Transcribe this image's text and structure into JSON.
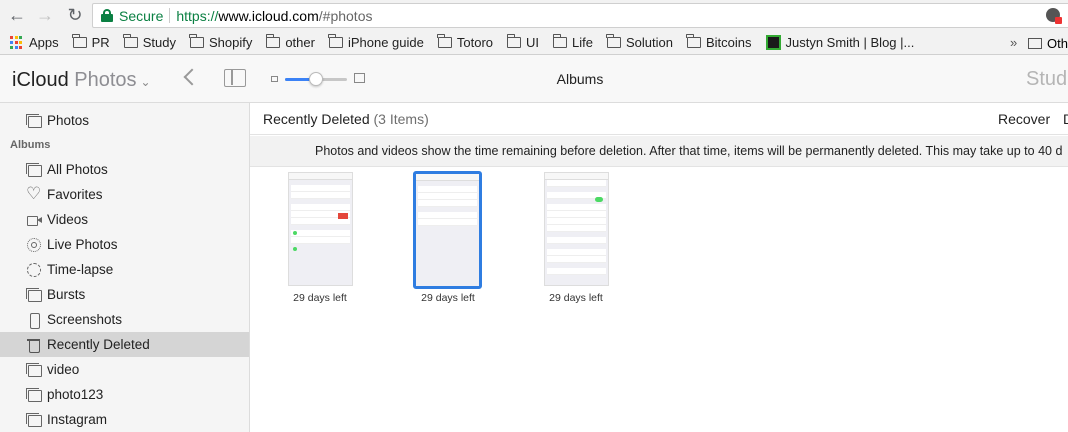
{
  "browser": {
    "secure_label": "Secure",
    "url_scheme": "https://",
    "url_host": "www.icloud.com",
    "url_path": "/#photos",
    "bookmarks": [
      {
        "label": "Apps",
        "icon": "apps-grid-icon"
      },
      {
        "label": "PR",
        "icon": "folder-icon"
      },
      {
        "label": "Study",
        "icon": "folder-icon"
      },
      {
        "label": "Shopify",
        "icon": "folder-icon"
      },
      {
        "label": "other",
        "icon": "folder-icon"
      },
      {
        "label": "iPhone guide",
        "icon": "folder-icon"
      },
      {
        "label": "Totoro",
        "icon": "folder-icon"
      },
      {
        "label": "UI",
        "icon": "folder-icon"
      },
      {
        "label": "Life",
        "icon": "folder-icon"
      },
      {
        "label": "Solution",
        "icon": "folder-icon"
      },
      {
        "label": "Bitcoins",
        "icon": "folder-icon"
      },
      {
        "label": "Justyn Smith | Blog |...",
        "icon": "site-favicon"
      }
    ],
    "bookmarks_more": "»",
    "bookmarks_last": "Oth"
  },
  "app": {
    "brand": "iCloud",
    "section": "Photos",
    "title": "Albums",
    "user": "Stud",
    "zoom_fraction": 0.5,
    "accent_color": "#3b82f6"
  },
  "sidebar": {
    "top_item": "Photos",
    "albums_heading": "Albums",
    "items": [
      {
        "label": "All Photos",
        "icon": "photos-stack-icon"
      },
      {
        "label": "Favorites",
        "icon": "heart-icon"
      },
      {
        "label": "Videos",
        "icon": "video-camera-icon"
      },
      {
        "label": "Live Photos",
        "icon": "live-photo-icon"
      },
      {
        "label": "Time-lapse",
        "icon": "timelapse-icon"
      },
      {
        "label": "Bursts",
        "icon": "bursts-stack-icon"
      },
      {
        "label": "Screenshots",
        "icon": "phone-screenshot-icon"
      },
      {
        "label": "Recently Deleted",
        "icon": "trash-icon",
        "selected": true
      },
      {
        "label": "video",
        "icon": "album-stack-icon"
      },
      {
        "label": "photo123",
        "icon": "album-stack-icon"
      },
      {
        "label": "Instagram",
        "icon": "album-stack-icon"
      }
    ]
  },
  "main": {
    "title": "Recently Deleted",
    "count": "(3 Items)",
    "recover_label": "Recover",
    "delete_label": "D",
    "notice": "Photos and videos show the time remaining before deletion. After that time, items will be permanently deleted. This may take up to 40 d",
    "items": [
      {
        "caption": "29 days left",
        "selected": false
      },
      {
        "caption": "29 days left",
        "selected": true
      },
      {
        "caption": "29 days left",
        "selected": false
      }
    ]
  }
}
